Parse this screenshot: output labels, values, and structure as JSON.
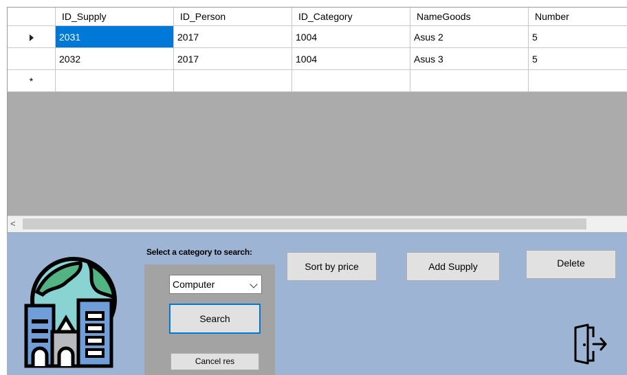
{
  "grid": {
    "columns": [
      "ID_Supply",
      "ID_Person",
      "ID_Category",
      "NameGoods",
      "Number"
    ],
    "rows": [
      {
        "marker": "current-row-icon",
        "cells": [
          "2031",
          "2017",
          "1004",
          "Asus 2",
          "5"
        ]
      },
      {
        "marker": "",
        "cells": [
          "2032",
          "2017",
          "1004",
          "Asus 3",
          "5"
        ]
      }
    ],
    "new_row_marker": "*",
    "scroll_left_arrow": "<"
  },
  "search": {
    "label": "Select a category to search:",
    "category_selected": "Computer",
    "search_button": "Search",
    "cancel_button": "Cancel res"
  },
  "actions": {
    "sort_button": "Sort by price",
    "add_button": "Add Supply",
    "delete_button": "Delete"
  },
  "icons": {
    "logo": "city-globe-icon",
    "exit": "exit-door-icon"
  },
  "colors": {
    "panel_background": "#9db4d5",
    "selection": "#0078d7",
    "grid_background": "#ababab"
  }
}
